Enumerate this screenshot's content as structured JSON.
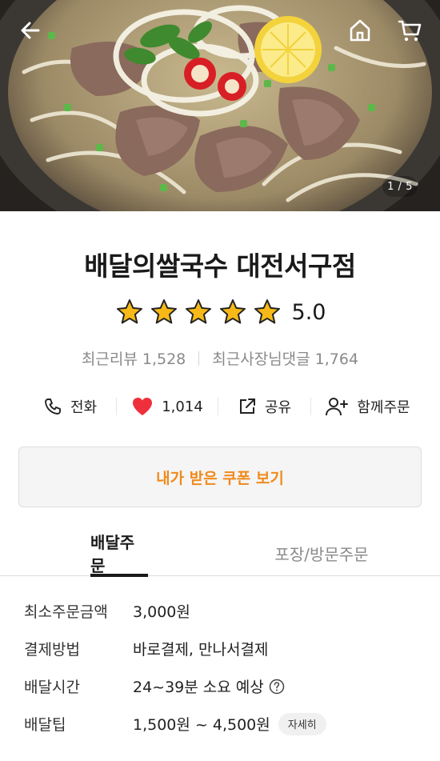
{
  "hero": {
    "pager": "1 / 5",
    "icons": [
      "back-arrow-icon",
      "home-icon",
      "cart-icon"
    ]
  },
  "store": {
    "name": "배달의쌀국수 대전서구점",
    "rating": 5.0,
    "rating_text": "5.0",
    "star_color": "#f7b917",
    "recent_reviews_text": "최근리뷰 1,528",
    "owner_replies_text": "최근사장님댓글 1,764"
  },
  "actions": {
    "call_label": "전화",
    "like_count": "1,014",
    "share_label": "공유",
    "group_order_label": "함께주문",
    "heart_color": "#ef2f3b"
  },
  "coupon": {
    "label": "내가 받은 쿠폰 보기",
    "color": "#f08a1c"
  },
  "tabs": {
    "delivery": "배달주문",
    "pickup": "포장/방문주문"
  },
  "info": {
    "min_order_label": "최소주문금액",
    "min_order_value": "3,000원",
    "payment_label": "결제방법",
    "payment_value": "바로결제, 만나서결제",
    "delivery_time_label": "배달시간",
    "delivery_time_value": "24~39분 소요 예상",
    "delivery_tip_label": "배달팁",
    "delivery_tip_value": "1,500원 ~ 4,500원",
    "detail_button": "자세히"
  }
}
